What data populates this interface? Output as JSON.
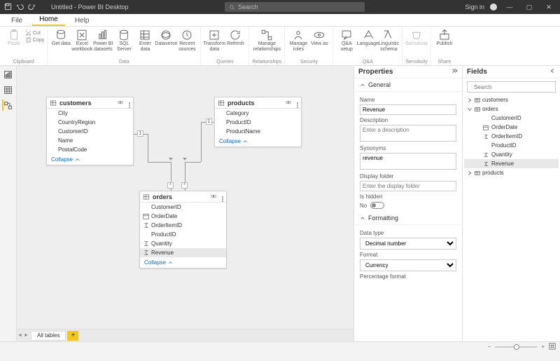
{
  "title": "Untitled - Power BI Desktop",
  "search_placeholder": "Search",
  "signin": "Sign in",
  "menu": {
    "file": "File",
    "home": "Home",
    "help": "Help"
  },
  "ribbon": {
    "clipboard": {
      "label": "Clipboard",
      "paste": "Paste",
      "cut": "Cut",
      "copy": "Copy"
    },
    "data": {
      "label": "Data",
      "get": "Get data",
      "excel": "Excel workbook",
      "pbi": "Power BI datasets",
      "sql": "SQL Server",
      "enter": "Enter data",
      "dataverse": "Dataverse",
      "recent": "Recent sources"
    },
    "queries": {
      "label": "Queries",
      "transform": "Transform data",
      "refresh": "Refresh"
    },
    "relationships": {
      "label": "Relationships",
      "manage": "Manage relationships"
    },
    "security": {
      "label": "Security",
      "roles": "Manage roles",
      "viewas": "View as"
    },
    "qa": {
      "label": "Q&A",
      "setup": "Q&A setup",
      "lang": "Language",
      "schema": "Linguistic schema"
    },
    "sensitivity": {
      "label": "Sensitivity",
      "btn": "Sensitivity"
    },
    "share": {
      "label": "Share",
      "publish": "Publish"
    }
  },
  "tables": {
    "customers": {
      "name": "customers",
      "fields": [
        "City",
        "CountryRegion",
        "CustomerID",
        "Name",
        "PostalCode"
      ],
      "collapse": "Collapse"
    },
    "products": {
      "name": "products",
      "fields": [
        "Category",
        "ProductID",
        "ProductName"
      ],
      "collapse": "Collapse"
    },
    "orders": {
      "name": "orders",
      "fields": [
        {
          "n": "CustomerID",
          "i": ""
        },
        {
          "n": "OrderDate",
          "i": "cal"
        },
        {
          "n": "OrderItemID",
          "i": "sum"
        },
        {
          "n": "ProductID",
          "i": ""
        },
        {
          "n": "Quantity",
          "i": "sum"
        },
        {
          "n": "Revenue",
          "i": "sum",
          "sel": true
        }
      ],
      "collapse": "Collapse"
    }
  },
  "cardinality": {
    "one": "1",
    "many": "*"
  },
  "bottom": {
    "tab": "All tables"
  },
  "properties": {
    "title": "Properties",
    "general": "General",
    "name_label": "Name",
    "name_value": "Revenue",
    "desc_label": "Description",
    "desc_ph": "Enter a description",
    "syn_label": "Synonyms",
    "syn_value": "revenue",
    "folder_label": "Display folder",
    "folder_ph": "Enter the display folder",
    "hidden_label": "Is hidden",
    "hidden_val": "No",
    "formatting": "Formatting",
    "dtype_label": "Data type",
    "dtype_val": "Decimal number",
    "format_label": "Format",
    "format_val": "Currency",
    "pct_label": "Percentage format"
  },
  "fields": {
    "title": "Fields",
    "search_ph": "Search",
    "customers": "customers",
    "orders": "orders",
    "products": "products",
    "items": [
      {
        "n": "CustomerID",
        "i": ""
      },
      {
        "n": "OrderDate",
        "i": "cal"
      },
      {
        "n": "OrderItemID",
        "i": "sum"
      },
      {
        "n": "ProductID",
        "i": ""
      },
      {
        "n": "Quantity",
        "i": "sum"
      },
      {
        "n": "Revenue",
        "i": "sum",
        "sel": true
      }
    ]
  }
}
